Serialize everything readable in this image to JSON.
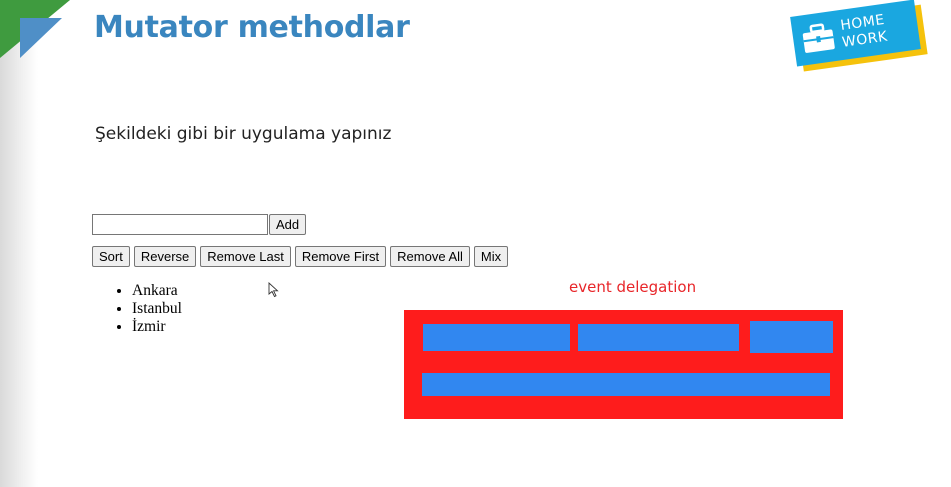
{
  "slide": {
    "title": "Mutator methodlar",
    "badge": {
      "line1": "HOME",
      "line2": "WORK",
      "icon": "briefcase-icon"
    },
    "instruction": "Şekildeki gibi bir uygulama yapınız"
  },
  "app": {
    "input": {
      "value": "",
      "placeholder": ""
    },
    "add_label": "Add",
    "buttons": [
      {
        "label": "Sort"
      },
      {
        "label": "Reverse"
      },
      {
        "label": "Remove Last"
      },
      {
        "label": "Remove First"
      },
      {
        "label": "Remove All"
      },
      {
        "label": "Mix"
      }
    ],
    "cities": [
      "Ankara",
      "Istanbul",
      "İzmir"
    ]
  },
  "diagram": {
    "label": "event delegation",
    "colors": {
      "container": "#fe1c1c",
      "child": "#3187f0",
      "label": "#e8262a"
    }
  },
  "colors": {
    "title": "#3a86bf",
    "badge_blue": "#1aa7e0",
    "badge_yellow": "#f5c20c",
    "corner_green": "#3f9b3f"
  }
}
